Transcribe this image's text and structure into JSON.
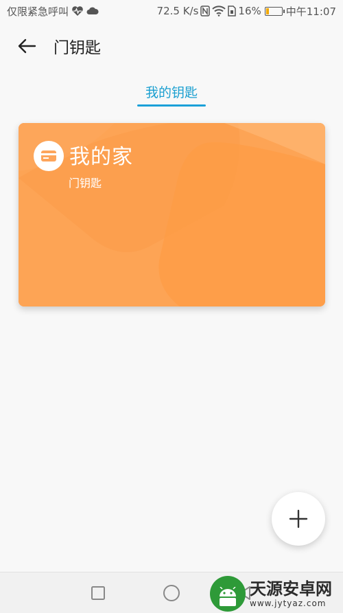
{
  "status_bar": {
    "carrier_text": "仅限紧急呼叫",
    "speed": "72.5 K/s",
    "battery_percent": "16%",
    "time": "中午11:07",
    "battery_level": 0.16,
    "icons": [
      "health-icon",
      "cloud-icon",
      "nfc-icon",
      "wifi-icon",
      "sim-icon",
      "battery-icon"
    ]
  },
  "app_bar": {
    "title": "门钥匙"
  },
  "tabs": [
    {
      "label": "我的钥匙",
      "active": true
    }
  ],
  "keys": [
    {
      "name": "我的家",
      "type": "门钥匙"
    }
  ],
  "colors": {
    "accent": "#1aa0d8",
    "card_orange": "#fda65b",
    "watermark_green": "#2e9a38"
  },
  "watermark": {
    "title": "天源安卓网",
    "url": "www.jytyaz.com"
  }
}
